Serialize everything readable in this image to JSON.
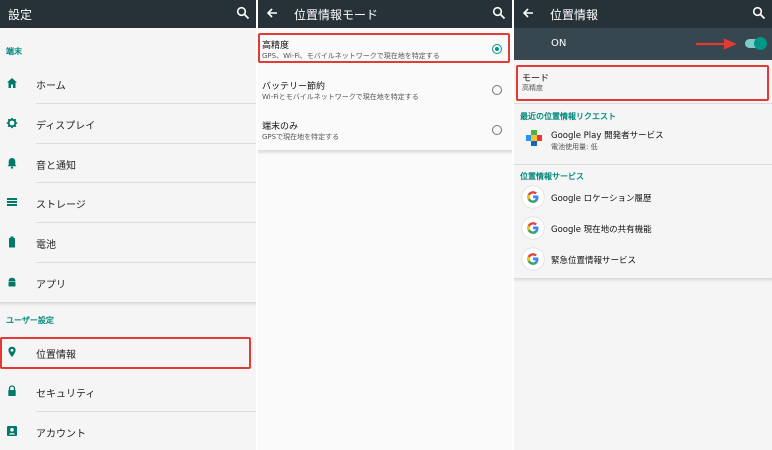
{
  "panel1": {
    "title": "設定",
    "section_device": "端末",
    "device_items": [
      {
        "label": "ホーム",
        "icon": "home-icon"
      },
      {
        "label": "ディスプレイ",
        "icon": "brightness-icon"
      },
      {
        "label": "音と通知",
        "icon": "bell-icon"
      },
      {
        "label": "ストレージ",
        "icon": "storage-icon"
      },
      {
        "label": "電池",
        "icon": "battery-icon"
      },
      {
        "label": "アプリ",
        "icon": "android-icon"
      }
    ],
    "section_user": "ユーザー設定",
    "user_items": [
      {
        "label": "位置情報",
        "icon": "location-pin-icon"
      },
      {
        "label": "セキュリティ",
        "icon": "lock-icon"
      },
      {
        "label": "アカウント",
        "icon": "account-icon"
      }
    ]
  },
  "panel2": {
    "title": "位置情報モード",
    "modes": [
      {
        "title": "高精度",
        "subtitle": "GPS、Wi-Fi、モバイルネットワークで現在地を特定する",
        "selected": true
      },
      {
        "title": "バッテリー節約",
        "subtitle": "Wi-Fiとモバイルネットワークで現在地を特定する",
        "selected": false
      },
      {
        "title": "端末のみ",
        "subtitle": "GPSで現在地を特定する",
        "selected": false
      }
    ]
  },
  "panel3": {
    "title": "位置情報",
    "switch_label": "ON",
    "switch_on": true,
    "mode_title": "モード",
    "mode_value": "高精度",
    "section_recent": "最近の位置情報リクエスト",
    "recent_app": {
      "name": "Google Play 開発者サービス",
      "detail": "電池使用量: 低"
    },
    "section_services": "位置情報サービス",
    "services": [
      {
        "label": "Google ロケーション履歴"
      },
      {
        "label": "Google 現在地の共有機能"
      },
      {
        "label": "緊急位置情報サービス"
      }
    ]
  },
  "colors": {
    "topbar": "#263238",
    "accent": "#009688",
    "highlight": "#e53935"
  }
}
